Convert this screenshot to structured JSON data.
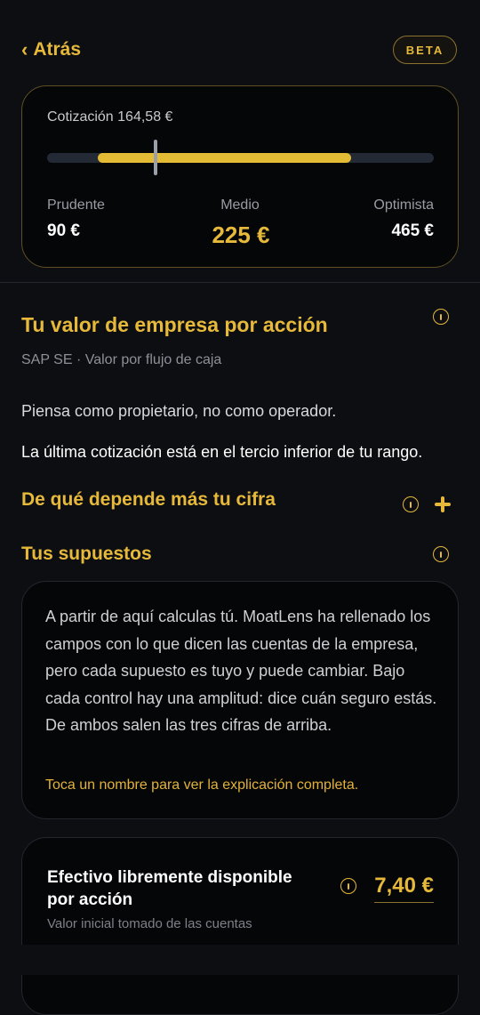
{
  "header": {
    "back_label": "Atrás",
    "badge": "BETA"
  },
  "valuation": {
    "quote_label": "Cotización 164,58 €",
    "quote_value_eur": 164.58,
    "range_low_eur": 90,
    "range_high_eur": 465,
    "prudent_label": "Prudente",
    "prudent_value": "90 €",
    "medium_label": "Medio",
    "medium_value": "225 €",
    "optimist_label": "Optimista",
    "optimist_value": "465 €"
  },
  "section": {
    "title": "Tu valor de empresa por acción",
    "subtitle": "SAP SE · Valor por flujo de caja",
    "paragraph1": "Piensa como propietario, no como operador.",
    "paragraph2": "La última cotización está en el tercio inferior de tu rango.",
    "depends_title": "De qué depende más tu cifra",
    "assumptions_title": "Tus supuestos"
  },
  "explanation": {
    "text": "A partir de aquí calculas tú. MoatLens ha rellenado los campos con lo que dicen las cuentas de la empresa, pero cada supuesto es tuyo y puede cambiar. Bajo cada control hay una amplitud: dice cuán seguro estás. De ambos salen las tres cifras de arriba.",
    "hint": "Toca un nombre para ver la explicación completa."
  },
  "fcf_card": {
    "name": "Efectivo libremente disponible por acción",
    "note": "Valor inicial tomado de las cuentas",
    "value": "7,40 €"
  },
  "colors": {
    "accent": "#e7b93a",
    "background": "#0c0e12",
    "card": "#050608"
  },
  "icons": [
    "chevron-left-icon",
    "info-icon",
    "plus-icon"
  ]
}
